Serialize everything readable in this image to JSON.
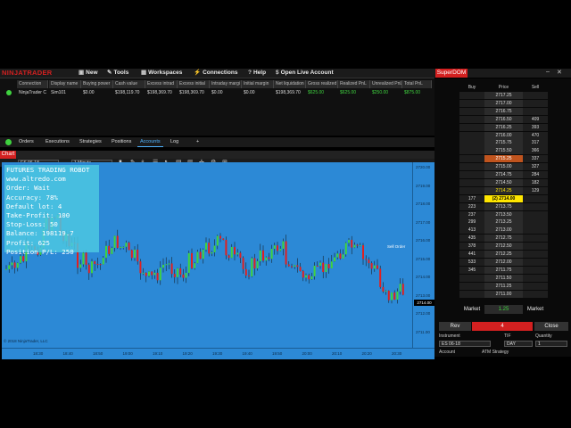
{
  "menubar": {
    "logo": "NINJATRADER",
    "items": [
      "New",
      "Tools",
      "Workspaces",
      "Connections",
      "Help",
      "Open Live Account"
    ]
  },
  "accounts": {
    "headers": [
      "Connection",
      "Display name",
      "Buying power",
      "Cash value",
      "Excess intrad",
      "Excess initial",
      "Intraday margi",
      "Initial margin",
      "Net liquidation",
      "Gross realized",
      "Realized PnL",
      "Unrealized PnL",
      "Total PnL"
    ],
    "row": [
      "NinjaTrader C",
      "Sim101",
      "$0.00",
      "$198,119.70",
      "$198,369.70",
      "$198,369.70",
      "$0.00",
      "$0.00",
      "$198,369.70",
      "$625.00",
      "$625.00",
      "$250.00",
      "$875.00"
    ]
  },
  "tabs": [
    "Orders",
    "Executions",
    "Strategies",
    "Positions",
    "Accounts",
    "Log",
    "+"
  ],
  "chart": {
    "window_title": "Chart",
    "instrument": "ES 06-18",
    "interval": "1 Minute",
    "copyright": "© 2018 NinjaTrader, LLC",
    "last_price": "2714.00",
    "price_ticks": [
      "2720.00",
      "2719.00",
      "2718.00",
      "2717.00",
      "2716.00",
      "2715.00",
      "2714.00",
      "2713.00",
      "2712.00",
      "2711.00"
    ],
    "time_ticks": [
      "18:30",
      "18:40",
      "18:50",
      "19:00",
      "19:10",
      "19:20",
      "19:30",
      "19:40",
      "19:50",
      "20:00",
      "20:10",
      "20:20",
      "20:30"
    ],
    "annotation": "Sell Order"
  },
  "robot": {
    "lines": [
      "FUTURES TRADING ROBOT",
      "www.altredo.com",
      "Order: Wait",
      "Accuracy: 78%",
      "Default lot: 4",
      "Take-Profit: 100",
      "Stop-Loss: 50",
      "Balance: 198119.7",
      "Profit: 625",
      "Position P/L: 250"
    ]
  },
  "superdom": {
    "title": "SuperDOM",
    "col_buy": "Buy",
    "col_price": "Price",
    "col_sell": "Sell",
    "rows": [
      {
        "buy": "",
        "price": "2717.25",
        "sell": ""
      },
      {
        "buy": "",
        "price": "2717.00",
        "sell": ""
      },
      {
        "buy": "",
        "price": "2716.75",
        "sell": ""
      },
      {
        "buy": "",
        "price": "2716.50",
        "sell": "409"
      },
      {
        "buy": "",
        "price": "2716.25",
        "sell": "393"
      },
      {
        "buy": "",
        "price": "2716.00",
        "sell": "470"
      },
      {
        "buy": "",
        "price": "2715.75",
        "sell": "317"
      },
      {
        "buy": "",
        "price": "2715.50",
        "sell": "366"
      },
      {
        "buy": "",
        "price": "2715.25",
        "sell": "337"
      },
      {
        "buy": "",
        "price": "2715.00",
        "sell": "327"
      },
      {
        "buy": "",
        "price": "2714.75",
        "sell": "284"
      },
      {
        "buy": "",
        "price": "2714.50",
        "sell": "182"
      },
      {
        "buy": "",
        "price": "2714.25",
        "sell": "129"
      },
      {
        "buy": "177",
        "price": "(2) 2714.00",
        "sell": ""
      },
      {
        "buy": "223",
        "price": "2713.75",
        "sell": ""
      },
      {
        "buy": "237",
        "price": "2713.50",
        "sell": ""
      },
      {
        "buy": "299",
        "price": "2713.25",
        "sell": ""
      },
      {
        "buy": "413",
        "price": "2713.00",
        "sell": ""
      },
      {
        "buy": "435",
        "price": "2712.75",
        "sell": ""
      },
      {
        "buy": "378",
        "price": "2712.50",
        "sell": ""
      },
      {
        "buy": "441",
        "price": "2712.25",
        "sell": ""
      },
      {
        "buy": "533",
        "price": "2712.00",
        "sell": ""
      },
      {
        "buy": "345",
        "price": "2711.75",
        "sell": ""
      },
      {
        "buy": "",
        "price": "2711.50",
        "sell": ""
      },
      {
        "buy": "",
        "price": "2711.25",
        "sell": ""
      },
      {
        "buy": "",
        "price": "2711.00",
        "sell": ""
      }
    ],
    "market_buy": "Market",
    "market_sell": "Market",
    "center_value": "1.25",
    "rev": "Rev",
    "qty_display": "4",
    "close": "Close",
    "instrument_label": "Instrument",
    "instrument": "ES 06-18",
    "tif_label": "TIF",
    "tif": "DAY",
    "quantity_label": "Quantity",
    "quantity": "1",
    "account_label": "Account",
    "atm_label": "ATM Strategy"
  },
  "colors": {
    "accent_red": "#d32020",
    "chart_bg": "#2c89d6",
    "bull": "#3fd23f",
    "bear": "#e02020"
  }
}
